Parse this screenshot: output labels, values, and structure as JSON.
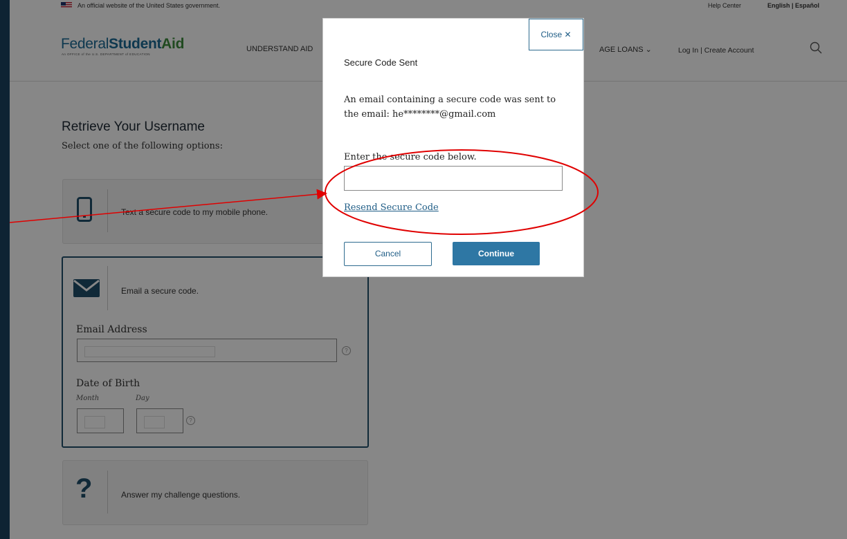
{
  "gov_banner": {
    "official_text": "An official website of the United States government.",
    "help_center": "Help Center",
    "language": "English | Español"
  },
  "header": {
    "logo_federal": "Federal",
    "logo_student": "Student",
    "logo_aid": "Aid",
    "logo_sub": "An OFFICE of the U.S. DEPARTMENT of EDUCATION",
    "nav_understand_aid": "UNDERSTAND AID",
    "nav_loans": "AGE LOANS",
    "login_text": "Log In | Create Account",
    "search_icon": "search-icon"
  },
  "main": {
    "title": "Retrieve Your Username",
    "subtitle": "Select one of the following options:",
    "options": [
      {
        "icon": "mobile-phone-icon",
        "label": "Text a secure code to my mobile phone."
      },
      {
        "icon": "envelope-icon",
        "label": "Email a secure code."
      },
      {
        "icon": "question-mark-icon",
        "label": "Answer my challenge questions."
      }
    ],
    "email_label": "Email Address",
    "dob_label": "Date of Birth",
    "month_label": "Month",
    "day_label": "Day"
  },
  "modal": {
    "close_label": "Close ✕",
    "title": "Secure Code Sent",
    "message": "An email containing a secure code was sent to the email: he********@gmail.com",
    "instruction": "Enter the secure code below.",
    "code_value": "",
    "resend_link": "Resend Secure Code",
    "cancel_label": "Cancel",
    "continue_label": "Continue"
  },
  "colors": {
    "overlay": "#000000",
    "accent": "#2e77a4",
    "annotation": "#e00000",
    "frame_border": "#1b4260"
  }
}
